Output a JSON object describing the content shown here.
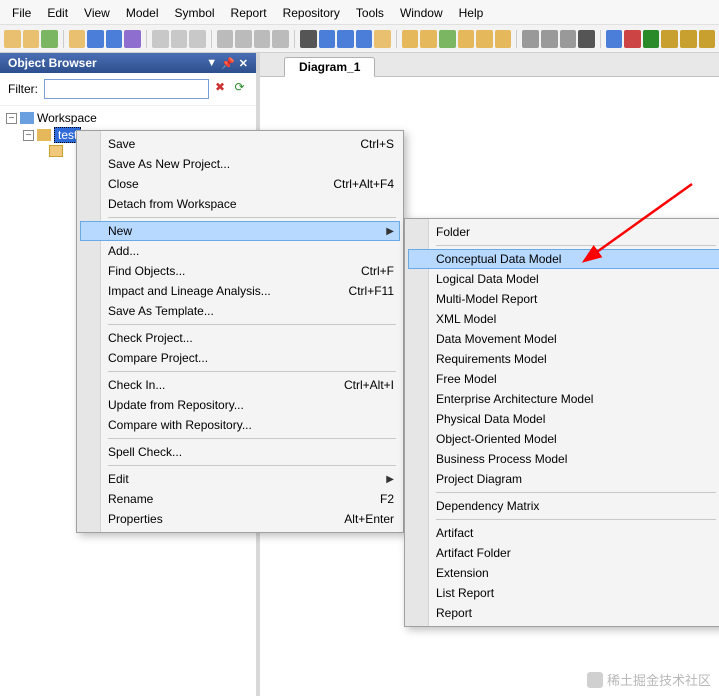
{
  "menubar": [
    "File",
    "Edit",
    "View",
    "Model",
    "Symbol",
    "Report",
    "Repository",
    "Tools",
    "Window",
    "Help"
  ],
  "toolbar_colors": [
    "#e8c070",
    "#e8c070",
    "#7bb662",
    "#e8c070",
    "#4a7ed8",
    "#4a7ed8",
    "#8e6fcf",
    "#c8c8c8",
    "#c8c8c8",
    "#c8c8c8",
    "#bbbbbb",
    "#bbbbbb",
    "#bbbbbb",
    "#bbbbbb",
    "#555555",
    "#4a7ed8",
    "#4a7ed8",
    "#4a7ed8",
    "#e8c070",
    "#e6b85c",
    "#e6b85c",
    "#7bb662",
    "#e6b85c",
    "#e6b85c",
    "#e6b85c",
    "#999999",
    "#999999",
    "#999999",
    "#555555",
    "#4a7ed8",
    "#cc4444",
    "#2a8a2a",
    "#c8a030",
    "#c8a030",
    "#c8a030"
  ],
  "panel": {
    "title": "Object Browser",
    "filter_label": "Filter:",
    "filter_value": ""
  },
  "tree": {
    "workspace": "Workspace",
    "project": "test",
    "child": ""
  },
  "tab": {
    "label": "Diagram_1"
  },
  "context_menu": [
    {
      "label": "Save",
      "shortcut": "Ctrl+S"
    },
    {
      "label": "Save As New Project..."
    },
    {
      "label": "Close",
      "shortcut": "Ctrl+Alt+F4"
    },
    {
      "label": "Detach from Workspace"
    },
    {
      "sep": true
    },
    {
      "label": "New",
      "submenu": true,
      "highlight": true
    },
    {
      "label": "Add..."
    },
    {
      "label": "Find Objects...",
      "shortcut": "Ctrl+F"
    },
    {
      "label": "Impact and Lineage Analysis...",
      "shortcut": "Ctrl+F11"
    },
    {
      "label": "Save As Template..."
    },
    {
      "sep": true
    },
    {
      "label": "Check Project..."
    },
    {
      "label": "Compare Project..."
    },
    {
      "sep": true
    },
    {
      "label": "Check In...",
      "shortcut": "Ctrl+Alt+I"
    },
    {
      "label": "Update from Repository..."
    },
    {
      "label": "Compare with Repository..."
    },
    {
      "sep": true
    },
    {
      "label": "Spell Check..."
    },
    {
      "sep": true
    },
    {
      "label": "Edit",
      "submenu": true
    },
    {
      "label": "Rename",
      "shortcut": "F2"
    },
    {
      "label": "Properties",
      "shortcut": "Alt+Enter"
    }
  ],
  "submenu": [
    {
      "label": "Folder"
    },
    {
      "sep": true
    },
    {
      "label": "Conceptual Data Model",
      "highlight": true
    },
    {
      "label": "Logical Data Model"
    },
    {
      "label": "Multi-Model Report"
    },
    {
      "label": "XML Model"
    },
    {
      "label": "Data Movement Model"
    },
    {
      "label": "Requirements Model"
    },
    {
      "label": "Free Model"
    },
    {
      "label": "Enterprise Architecture Model"
    },
    {
      "label": "Physical Data Model"
    },
    {
      "label": "Object-Oriented Model"
    },
    {
      "label": "Business Process Model"
    },
    {
      "label": "Project Diagram"
    },
    {
      "sep": true
    },
    {
      "label": "Dependency Matrix"
    },
    {
      "sep": true
    },
    {
      "label": "Artifact"
    },
    {
      "label": "Artifact Folder"
    },
    {
      "label": "Extension"
    },
    {
      "label": "List Report"
    },
    {
      "label": "Report"
    }
  ],
  "watermark": "稀土掘金技术社区"
}
